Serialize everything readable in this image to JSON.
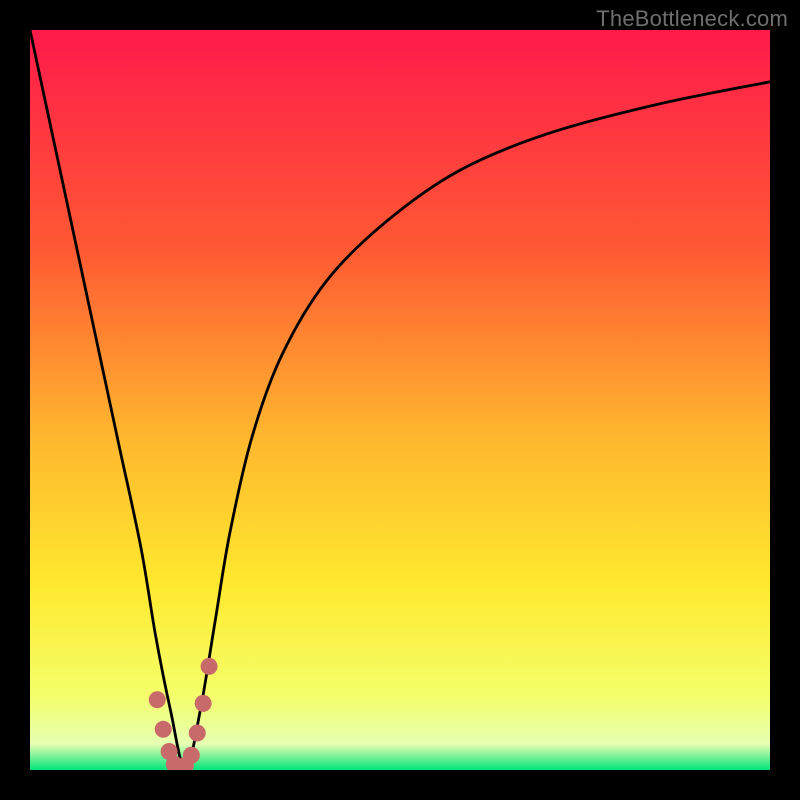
{
  "watermark": "TheBottleneck.com",
  "chart_data": {
    "type": "line",
    "title": "",
    "xlabel": "",
    "ylabel": "",
    "xlim": [
      0,
      100
    ],
    "ylim": [
      0,
      100
    ],
    "grid": false,
    "legend": false,
    "gradient_stops": [
      {
        "offset": 0,
        "color": "#ff1a4b"
      },
      {
        "offset": 30,
        "color": "#ff5a33"
      },
      {
        "offset": 55,
        "color": "#ffb72e"
      },
      {
        "offset": 75,
        "color": "#ffe92e"
      },
      {
        "offset": 90,
        "color": "#f4ff6a"
      },
      {
        "offset": 96.5,
        "color": "#e6ffb2"
      },
      {
        "offset": 100,
        "color": "#00e47a"
      }
    ],
    "series": [
      {
        "name": "bottleneck-curve",
        "color": "#000000",
        "x": [
          0,
          3,
          6,
          9,
          12,
          15,
          17,
          19,
          21,
          23,
          25,
          27,
          30,
          34,
          40,
          48,
          58,
          70,
          85,
          100
        ],
        "y": [
          100,
          86,
          72,
          58,
          44,
          30,
          18,
          8,
          0,
          8,
          20,
          32,
          45,
          56,
          66,
          74,
          81,
          86,
          90,
          93
        ]
      }
    ],
    "highlight": {
      "name": "valley-dots",
      "color": "#c96a6a",
      "x": [
        17.2,
        18.0,
        18.8,
        19.5,
        20.2,
        21.0,
        21.8,
        22.6,
        23.4,
        24.2
      ],
      "y": [
        9.5,
        5.5,
        2.5,
        0.8,
        0.2,
        0.6,
        2.0,
        5.0,
        9.0,
        14.0
      ]
    }
  }
}
